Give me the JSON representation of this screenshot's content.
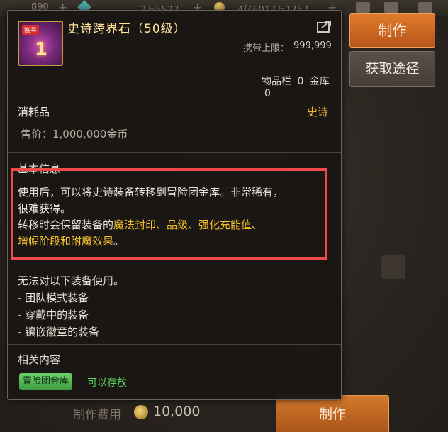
{
  "topbar": {
    "stat1": "890",
    "stat2": "2万5523",
    "stat3": "4亿6017万1757"
  },
  "side_buttons": {
    "make": "制作",
    "source": "获取途径"
  },
  "item": {
    "title": "史诗跨界石（50级）",
    "icon_tag": "账号",
    "icon_number": "1",
    "carry_label": "携带上限：",
    "carry_value": "999,999",
    "inventory_label": "物品栏",
    "inventory_value": "0",
    "storage_label": "金库",
    "storage_value": "0",
    "category": "消耗品",
    "rarity": "史诗",
    "rarity_color": "#f2b62c",
    "price": "售价：1,000,000金币"
  },
  "basic_info": {
    "title": "基本信息",
    "line1": "使用后，可以将史诗装备转移到冒险团金库。非常稀有，",
    "line2": "很难获得。",
    "line3_plain": "转移时会保留装备的",
    "line3_highlight": "魔法封印、品级、强化充能值、",
    "line4_highlight": "增幅阶段和附魔效果",
    "line4_end": "。"
  },
  "restrictions": {
    "intro": "无法对以下装备使用。",
    "items": [
      "- 团队模式装备",
      "- 穿戴中的装备",
      "- 镶嵌徽章的装备"
    ]
  },
  "related": {
    "title": "相关内容",
    "tag": "冒险团金库",
    "status": "可以存放",
    "status_color": "#5fd65f"
  },
  "bottom": {
    "cost_label": "制作费用",
    "cost_value": "10,000",
    "make_button": "制作"
  },
  "background": {
    "ghost_text": "1102111001"
  }
}
